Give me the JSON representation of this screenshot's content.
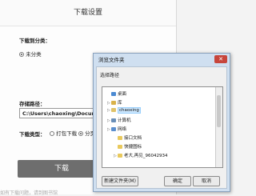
{
  "download_dialog": {
    "title": "下载设置",
    "category_label": "下载到分类：",
    "category_option": "未分类",
    "path_label": "存储路径：",
    "path_value": "C:\\Users\\chaoxing\\Documents\\",
    "type_label": "下载类型：",
    "type_option_pack": "打包下载",
    "type_option_page": "分页下载",
    "download_button": "下载",
    "footer_text": "如有下载问题，请到图书馆"
  },
  "browse_dialog": {
    "title": "浏览文件夹",
    "close_glyph": "✕",
    "prompt": "选择路径",
    "tree": [
      {
        "label": "桌面",
        "icon": "desktop-icon",
        "color": "#4b8ad2"
      },
      {
        "label": "库",
        "icon": "library-icon",
        "color": "#d9b24a"
      },
      {
        "label": "chaoxing",
        "icon": "user-folder-icon",
        "color": "#e0c36a"
      },
      {
        "label": "计算机",
        "icon": "computer-icon",
        "color": "#6a8fb8"
      },
      {
        "label": "网络",
        "icon": "network-icon",
        "color": "#5b8fcf"
      },
      {
        "label": "接口文档",
        "icon": "folder-icon",
        "color": "#e9c95c"
      },
      {
        "label": "快捷图标",
        "icon": "folder-icon",
        "color": "#e9c95c"
      },
      {
        "label": "老大,再见_96042934",
        "icon": "folder-icon",
        "color": "#e9c95c"
      }
    ],
    "new_folder_button": "新建文件夹(M)",
    "ok_button": "确定",
    "cancel_button": "取消"
  }
}
